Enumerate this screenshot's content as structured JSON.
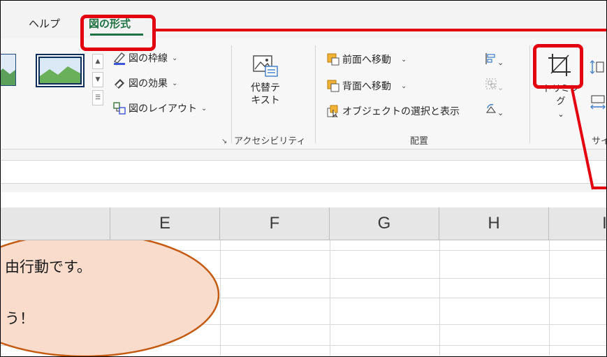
{
  "tabs": {
    "help": "ヘルプ",
    "picture_format": "図の形式"
  },
  "picture_styles": {
    "border": "図の枠線",
    "effects": "図の効果",
    "layout": "図のレイアウト"
  },
  "accessibility": {
    "alt_text_line1": "代替テ",
    "alt_text_line2": "キスト",
    "group_label": "アクセシビリティ"
  },
  "arrange": {
    "bring_forward": "前面へ移動",
    "send_backward": "背面へ移動",
    "selection_pane": "オブジェクトの選択と表示",
    "group_label": "配置"
  },
  "size": {
    "crop_label": "トリミング",
    "group_label_partial": "サイ"
  },
  "columns": [
    "E",
    "F",
    "G",
    "H",
    "I"
  ],
  "shape": {
    "line1": "由行動です。",
    "line2": "う！"
  },
  "colors": {
    "accent_green": "#1f7244",
    "callout_red": "#e3000f",
    "shape_fill": "#f9dccb",
    "shape_border": "#c55a11"
  }
}
